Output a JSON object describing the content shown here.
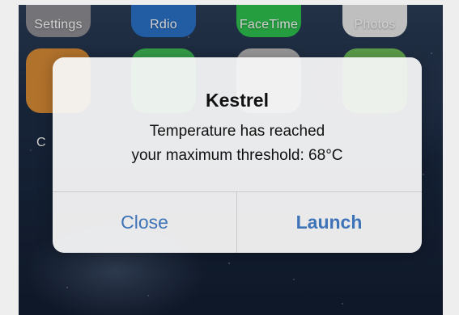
{
  "home_screen": {
    "apps_row_1": [
      {
        "label": "Settings",
        "icon": "settings-icon",
        "color": "#8e8e93"
      },
      {
        "label": "Rdio",
        "icon": "rdio-icon",
        "color": "#2a72c9"
      },
      {
        "label": "FaceTime",
        "icon": "facetime-icon",
        "color": "#2ec14f"
      },
      {
        "label": "Photos",
        "icon": "photos-icon",
        "color": "#e9e9e9"
      }
    ],
    "apps_row_2": [
      {
        "label": "C",
        "icon": "calendar-like-icon",
        "color": "#d88b36"
      },
      {
        "label": "",
        "icon": "messages-like-icon",
        "color": "#3fbe57"
      },
      {
        "label": "",
        "icon": "camera-like-icon",
        "color": "#b7b7b7"
      },
      {
        "label": "",
        "icon": "maps-like-icon",
        "color": "#6fbf5a"
      }
    ]
  },
  "alert": {
    "title": "Kestrel",
    "message_line_1": "Temperature has reached",
    "message_line_2": "your maximum threshold: 68°C",
    "buttons": {
      "close": "Close",
      "launch": "Launch"
    }
  },
  "colors": {
    "alert_button_text": "#3f73b8",
    "alert_background": "#f6f6f6"
  }
}
